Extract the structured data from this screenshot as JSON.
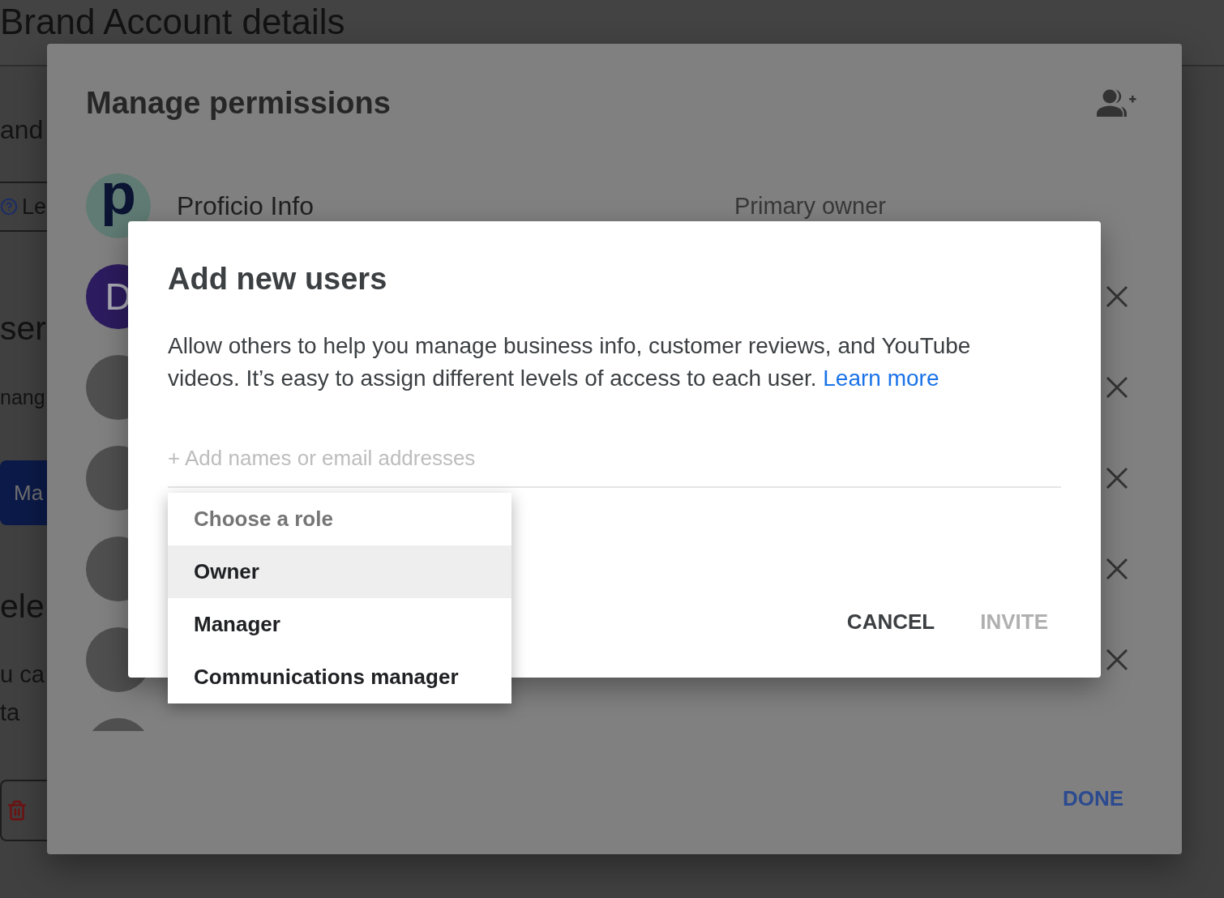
{
  "background_page": {
    "title": "Brand Account details",
    "sections": [
      {
        "text": "and",
        "help_link": "Le"
      },
      {
        "heading": "ser",
        "text": "nang",
        "button": "Ma"
      },
      {
        "heading": "ele",
        "text_lines": [
          "u ca",
          "ta"
        ],
        "delete_button": true
      }
    ]
  },
  "manage_permissions": {
    "title": "Manage permissions",
    "users": [
      {
        "avatar": {
          "kind": "logo",
          "letter": "p",
          "color": "#5f7b73"
        },
        "name": "Proficio Info",
        "role": "Primary owner",
        "removable": false
      },
      {
        "avatar": {
          "kind": "letter",
          "letter": "D",
          "color": "#2c1b5e"
        },
        "removable": true
      },
      {
        "avatar": {
          "kind": "photo"
        },
        "removable": true
      },
      {
        "avatar": {
          "kind": "photo"
        },
        "removable": true
      },
      {
        "avatar": {
          "kind": "photo"
        },
        "removable": true
      },
      {
        "avatar": {
          "kind": "photo"
        },
        "removable": true
      },
      {
        "avatar": {
          "kind": "photo"
        }
      }
    ],
    "done_button": "DONE"
  },
  "add_users_dialog": {
    "title": "Add new users",
    "description": "Allow others to help you manage business info, customer reviews, and YouTube videos. It’s easy to assign different levels of access to each user.",
    "link": "Learn more",
    "input": {
      "placeholder": "+ Add names or email addresses"
    },
    "role_menu": {
      "header": "Choose a role",
      "options": [
        {
          "label": "Owner",
          "selected": true
        },
        {
          "label": "Manager",
          "selected": false
        },
        {
          "label": "Communications manager",
          "selected": false
        }
      ]
    },
    "buttons": [
      {
        "label": "CANCEL",
        "disabled": false
      },
      {
        "label": "INVITE",
        "disabled": true
      }
    ]
  }
}
